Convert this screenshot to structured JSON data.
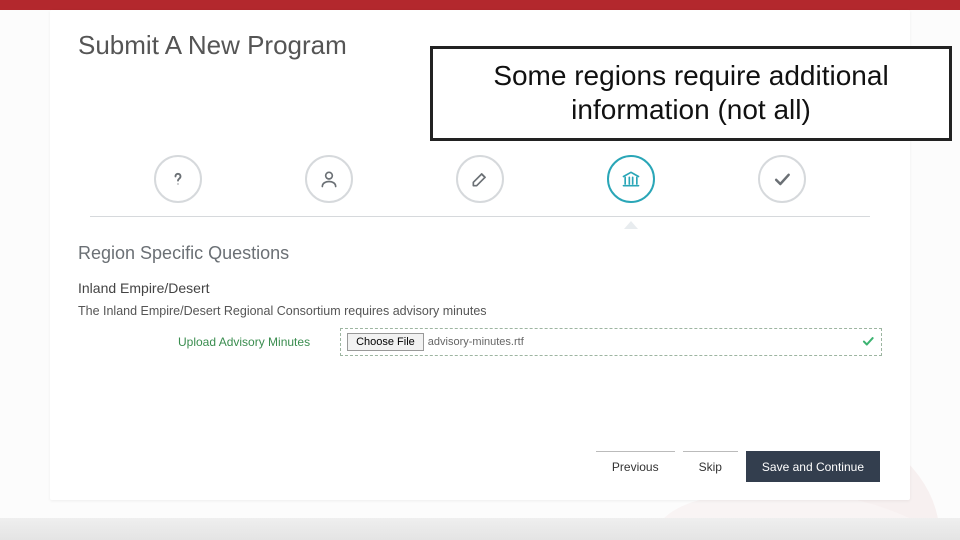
{
  "header": {
    "brand_bar_color": "#b3282d"
  },
  "page": {
    "title": "Submit A New Program",
    "callout_text": "Some regions require additional information (not all)"
  },
  "stepper": {
    "steps": [
      {
        "icon": "question",
        "active": false
      },
      {
        "icon": "user",
        "active": false
      },
      {
        "icon": "edit",
        "active": false
      },
      {
        "icon": "institution",
        "active": true
      },
      {
        "icon": "check",
        "active": false
      }
    ]
  },
  "section": {
    "heading": "Region Specific Questions",
    "region_name": "Inland Empire/Desert",
    "description": "The Inland Empire/Desert Regional Consortium requires advisory minutes",
    "upload": {
      "label": "Upload Advisory Minutes",
      "button_label": "Choose File",
      "file_name": "advisory-minutes.rtf",
      "status": "ok"
    }
  },
  "footer": {
    "previous": "Previous",
    "skip": "Skip",
    "save": "Save and Continue"
  }
}
